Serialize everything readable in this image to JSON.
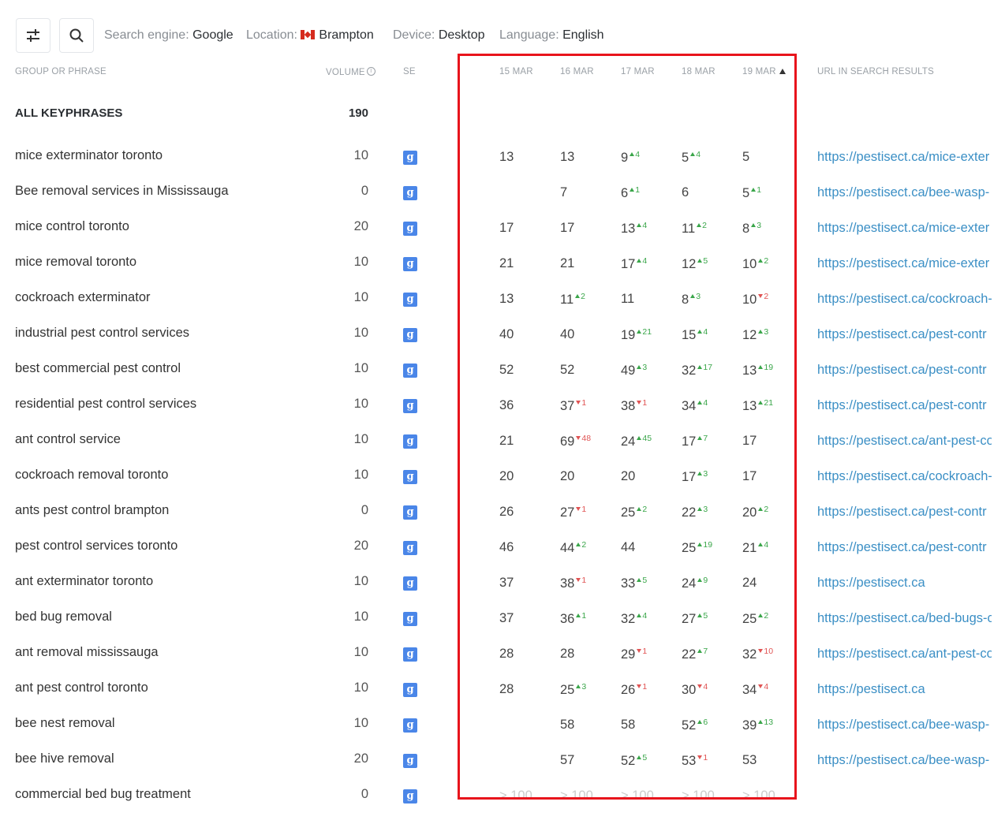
{
  "filters": {
    "search_engine": {
      "label": "Search engine:",
      "value": "Google"
    },
    "location": {
      "label": "Location:",
      "value": "Brampton",
      "flag": "canada-flag-icon"
    },
    "device": {
      "label": "Device:",
      "value": "Desktop"
    },
    "language": {
      "label": "Language:",
      "value": "English"
    }
  },
  "toolbar": {
    "filter_icon": "sliders-icon",
    "search_icon": "search-icon"
  },
  "headers": {
    "phrase": "GROUP OR PHRASE",
    "volume": "VOLUME",
    "se": "SE",
    "dates": [
      "15 MAR",
      "16 MAR",
      "17 MAR",
      "18 MAR",
      "19 MAR"
    ],
    "url": "URL IN SEARCH RESULTS"
  },
  "all": {
    "label": "ALL KEYPHRASES",
    "volume": "190"
  },
  "colors": {
    "up": "#3aa64a",
    "down": "#e05454",
    "link": "#3b8fc5",
    "highlight_box": "#e8141c",
    "google": "#4a86e8"
  },
  "rows": [
    {
      "phrase": "mice exterminator toronto",
      "volume": "10",
      "url": "https://pestisect.ca/mice-exter",
      "pos": [
        {
          "v": "13"
        },
        {
          "v": "13"
        },
        {
          "v": "9",
          "d": "4",
          "dir": "up"
        },
        {
          "v": "5",
          "d": "4",
          "dir": "up"
        },
        {
          "v": "5"
        }
      ]
    },
    {
      "phrase": "Bee removal services in Mississauga",
      "volume": "0",
      "url": "https://pestisect.ca/bee-wasp-",
      "pos": [
        {
          "v": ""
        },
        {
          "v": "7"
        },
        {
          "v": "6",
          "d": "1",
          "dir": "up"
        },
        {
          "v": "6"
        },
        {
          "v": "5",
          "d": "1",
          "dir": "up"
        }
      ]
    },
    {
      "phrase": "mice control toronto",
      "volume": "20",
      "url": "https://pestisect.ca/mice-exter",
      "pos": [
        {
          "v": "17"
        },
        {
          "v": "17"
        },
        {
          "v": "13",
          "d": "4",
          "dir": "up"
        },
        {
          "v": "11",
          "d": "2",
          "dir": "up"
        },
        {
          "v": "8",
          "d": "3",
          "dir": "up"
        }
      ]
    },
    {
      "phrase": "mice removal toronto",
      "volume": "10",
      "url": "https://pestisect.ca/mice-exter",
      "pos": [
        {
          "v": "21"
        },
        {
          "v": "21"
        },
        {
          "v": "17",
          "d": "4",
          "dir": "up"
        },
        {
          "v": "12",
          "d": "5",
          "dir": "up"
        },
        {
          "v": "10",
          "d": "2",
          "dir": "up"
        }
      ]
    },
    {
      "phrase": "cockroach exterminator",
      "volume": "10",
      "url": "https://pestisect.ca/cockroach-",
      "pos": [
        {
          "v": "13"
        },
        {
          "v": "11",
          "d": "2",
          "dir": "up"
        },
        {
          "v": "11"
        },
        {
          "v": "8",
          "d": "3",
          "dir": "up"
        },
        {
          "v": "10",
          "d": "2",
          "dir": "down"
        }
      ]
    },
    {
      "phrase": "industrial pest control services",
      "volume": "10",
      "url": "https://pestisect.ca/pest-contr",
      "pos": [
        {
          "v": "40"
        },
        {
          "v": "40"
        },
        {
          "v": "19",
          "d": "21",
          "dir": "up"
        },
        {
          "v": "15",
          "d": "4",
          "dir": "up"
        },
        {
          "v": "12",
          "d": "3",
          "dir": "up"
        }
      ]
    },
    {
      "phrase": "best commercial pest control",
      "volume": "10",
      "url": "https://pestisect.ca/pest-contr",
      "pos": [
        {
          "v": "52"
        },
        {
          "v": "52"
        },
        {
          "v": "49",
          "d": "3",
          "dir": "up"
        },
        {
          "v": "32",
          "d": "17",
          "dir": "up"
        },
        {
          "v": "13",
          "d": "19",
          "dir": "up"
        }
      ]
    },
    {
      "phrase": "residential pest control services",
      "volume": "10",
      "url": "https://pestisect.ca/pest-contr",
      "pos": [
        {
          "v": "36"
        },
        {
          "v": "37",
          "d": "1",
          "dir": "down"
        },
        {
          "v": "38",
          "d": "1",
          "dir": "down"
        },
        {
          "v": "34",
          "d": "4",
          "dir": "up"
        },
        {
          "v": "13",
          "d": "21",
          "dir": "up"
        }
      ]
    },
    {
      "phrase": "ant control service",
      "volume": "10",
      "url": "https://pestisect.ca/ant-pest-co",
      "pos": [
        {
          "v": "21"
        },
        {
          "v": "69",
          "d": "48",
          "dir": "down"
        },
        {
          "v": "24",
          "d": "45",
          "dir": "up"
        },
        {
          "v": "17",
          "d": "7",
          "dir": "up"
        },
        {
          "v": "17"
        }
      ]
    },
    {
      "phrase": "cockroach removal toronto",
      "volume": "10",
      "url": "https://pestisect.ca/cockroach-",
      "pos": [
        {
          "v": "20"
        },
        {
          "v": "20"
        },
        {
          "v": "20"
        },
        {
          "v": "17",
          "d": "3",
          "dir": "up"
        },
        {
          "v": "17"
        }
      ]
    },
    {
      "phrase": "ants pest control brampton",
      "volume": "0",
      "url": "https://pestisect.ca/pest-contr",
      "pos": [
        {
          "v": "26"
        },
        {
          "v": "27",
          "d": "1",
          "dir": "down"
        },
        {
          "v": "25",
          "d": "2",
          "dir": "up"
        },
        {
          "v": "22",
          "d": "3",
          "dir": "up"
        },
        {
          "v": "20",
          "d": "2",
          "dir": "up"
        }
      ]
    },
    {
      "phrase": "pest control services toronto",
      "volume": "20",
      "url": "https://pestisect.ca/pest-contr",
      "pos": [
        {
          "v": "46"
        },
        {
          "v": "44",
          "d": "2",
          "dir": "up"
        },
        {
          "v": "44"
        },
        {
          "v": "25",
          "d": "19",
          "dir": "up"
        },
        {
          "v": "21",
          "d": "4",
          "dir": "up"
        }
      ]
    },
    {
      "phrase": "ant exterminator toronto",
      "volume": "10",
      "url": "https://pestisect.ca",
      "pos": [
        {
          "v": "37"
        },
        {
          "v": "38",
          "d": "1",
          "dir": "down"
        },
        {
          "v": "33",
          "d": "5",
          "dir": "up"
        },
        {
          "v": "24",
          "d": "9",
          "dir": "up"
        },
        {
          "v": "24"
        }
      ]
    },
    {
      "phrase": "bed bug removal",
      "volume": "10",
      "url": "https://pestisect.ca/bed-bugs-c",
      "pos": [
        {
          "v": "37"
        },
        {
          "v": "36",
          "d": "1",
          "dir": "up"
        },
        {
          "v": "32",
          "d": "4",
          "dir": "up"
        },
        {
          "v": "27",
          "d": "5",
          "dir": "up"
        },
        {
          "v": "25",
          "d": "2",
          "dir": "up"
        }
      ]
    },
    {
      "phrase": "ant removal mississauga",
      "volume": "10",
      "url": "https://pestisect.ca/ant-pest-co",
      "pos": [
        {
          "v": "28"
        },
        {
          "v": "28"
        },
        {
          "v": "29",
          "d": "1",
          "dir": "down"
        },
        {
          "v": "22",
          "d": "7",
          "dir": "up"
        },
        {
          "v": "32",
          "d": "10",
          "dir": "down"
        }
      ]
    },
    {
      "phrase": "ant pest control toronto",
      "volume": "10",
      "url": "https://pestisect.ca",
      "pos": [
        {
          "v": "28"
        },
        {
          "v": "25",
          "d": "3",
          "dir": "up"
        },
        {
          "v": "26",
          "d": "1",
          "dir": "down"
        },
        {
          "v": "30",
          "d": "4",
          "dir": "down"
        },
        {
          "v": "34",
          "d": "4",
          "dir": "down"
        }
      ]
    },
    {
      "phrase": "bee nest removal",
      "volume": "10",
      "url": "https://pestisect.ca/bee-wasp-",
      "pos": [
        {
          "v": ""
        },
        {
          "v": "58"
        },
        {
          "v": "58"
        },
        {
          "v": "52",
          "d": "6",
          "dir": "up"
        },
        {
          "v": "39",
          "d": "13",
          "dir": "up"
        }
      ]
    },
    {
      "phrase": "bee hive removal",
      "volume": "20",
      "url": "https://pestisect.ca/bee-wasp-",
      "pos": [
        {
          "v": ""
        },
        {
          "v": "57"
        },
        {
          "v": "52",
          "d": "5",
          "dir": "up"
        },
        {
          "v": "53",
          "d": "1",
          "dir": "down"
        },
        {
          "v": "53"
        }
      ]
    },
    {
      "phrase": "commercial bed bug treatment",
      "volume": "0",
      "url": "",
      "pos": [
        {
          "v": "> 100",
          "faded": true
        },
        {
          "v": "> 100",
          "faded": true
        },
        {
          "v": "> 100",
          "faded": true
        },
        {
          "v": "> 100",
          "faded": true
        },
        {
          "v": "> 100",
          "faded": true
        }
      ]
    }
  ]
}
